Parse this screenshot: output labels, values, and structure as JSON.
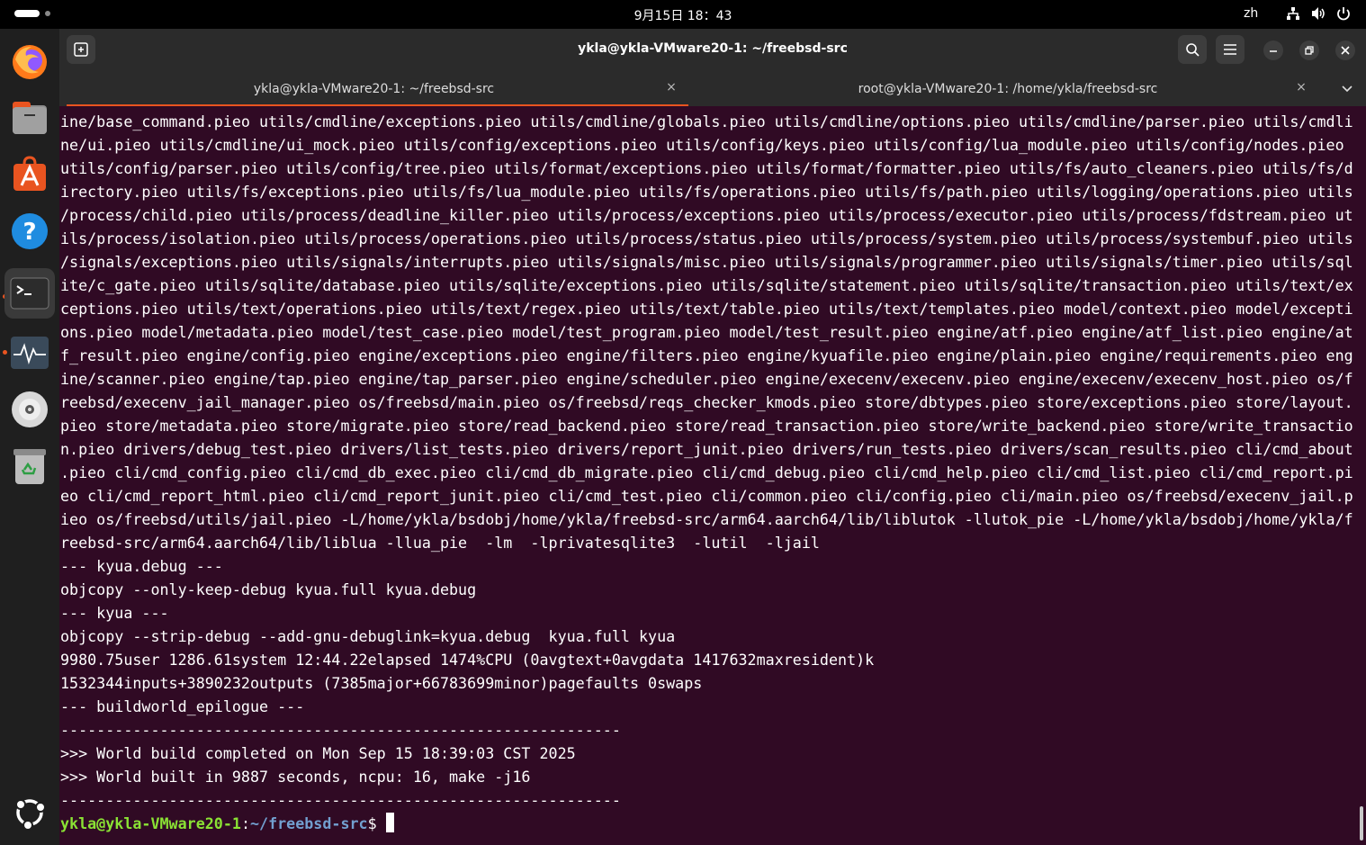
{
  "topbar": {
    "clock": "9月15日 18：43",
    "lang": "zh",
    "icons": [
      "network-icon",
      "volume-icon",
      "power-icon"
    ]
  },
  "dock": {
    "items": [
      "firefox-icon",
      "files-icon",
      "app-center-icon",
      "help-icon",
      "terminal-icon",
      "system-monitor-icon",
      "disc-icon",
      "trash-icon",
      "show-apps-icon"
    ]
  },
  "window": {
    "title": "ykla@ykla-VMware20-1: ~/freebsd-src",
    "tabs": [
      {
        "label": "ykla@ykla-VMware20-1: ~/freebsd-src",
        "active": true
      },
      {
        "label": "root@ykla-VMware20-1: /home/ykla/freebsd-src",
        "active": false
      }
    ],
    "close_glyph": "×"
  },
  "terminal": {
    "lines": [
      "ine/base_command.pieo utils/cmdline/exceptions.pieo utils/cmdline/globals.pieo utils/cmdline/options.pieo utils/cmdline/parser.pieo utils/cmdli",
      "ne/ui.pieo utils/cmdline/ui_mock.pieo utils/config/exceptions.pieo utils/config/keys.pieo utils/config/lua_module.pieo utils/config/nodes.pieo",
      "utils/config/parser.pieo utils/config/tree.pieo utils/format/exceptions.pieo utils/format/formatter.pieo utils/fs/auto_cleaners.pieo utils/fs/d",
      "irectory.pieo utils/fs/exceptions.pieo utils/fs/lua_module.pieo utils/fs/operations.pieo utils/fs/path.pieo utils/logging/operations.pieo utils",
      "/process/child.pieo utils/process/deadline_killer.pieo utils/process/exceptions.pieo utils/process/executor.pieo utils/process/fdstream.pieo ut",
      "ils/process/isolation.pieo utils/process/operations.pieo utils/process/status.pieo utils/process/system.pieo utils/process/systembuf.pieo utils",
      "/signals/exceptions.pieo utils/signals/interrupts.pieo utils/signals/misc.pieo utils/signals/programmer.pieo utils/signals/timer.pieo utils/sql",
      "ite/c_gate.pieo utils/sqlite/database.pieo utils/sqlite/exceptions.pieo utils/sqlite/statement.pieo utils/sqlite/transaction.pieo utils/text/ex",
      "ceptions.pieo utils/text/operations.pieo utils/text/regex.pieo utils/text/table.pieo utils/text/templates.pieo model/context.pieo model/excepti",
      "ons.pieo model/metadata.pieo model/test_case.pieo model/test_program.pieo model/test_result.pieo engine/atf.pieo engine/atf_list.pieo engine/at",
      "f_result.pieo engine/config.pieo engine/exceptions.pieo engine/filters.pieo engine/kyuafile.pieo engine/plain.pieo engine/requirements.pieo eng",
      "ine/scanner.pieo engine/tap.pieo engine/tap_parser.pieo engine/scheduler.pieo engine/execenv/execenv.pieo engine/execenv/execenv_host.pieo os/f",
      "reebsd/execenv_jail_manager.pieo os/freebsd/main.pieo os/freebsd/reqs_checker_kmods.pieo store/dbtypes.pieo store/exceptions.pieo store/layout.",
      "pieo store/metadata.pieo store/migrate.pieo store/read_backend.pieo store/read_transaction.pieo store/write_backend.pieo store/write_transactio",
      "n.pieo drivers/debug_test.pieo drivers/list_tests.pieo drivers/report_junit.pieo drivers/run_tests.pieo drivers/scan_results.pieo cli/cmd_about",
      ".pieo cli/cmd_config.pieo cli/cmd_db_exec.pieo cli/cmd_db_migrate.pieo cli/cmd_debug.pieo cli/cmd_help.pieo cli/cmd_list.pieo cli/cmd_report.pi",
      "eo cli/cmd_report_html.pieo cli/cmd_report_junit.pieo cli/cmd_test.pieo cli/common.pieo cli/config.pieo cli/main.pieo os/freebsd/execenv_jail.p",
      "ieo os/freebsd/utils/jail.pieo -L/home/ykla/bsdobj/home/ykla/freebsd-src/arm64.aarch64/lib/liblutok -llutok_pie -L/home/ykla/bsdobj/home/ykla/f",
      "reebsd-src/arm64.aarch64/lib/liblua -llua_pie  -lm  -lprivatesqlite3  -lutil  -ljail",
      "--- kyua.debug ---",
      "objcopy --only-keep-debug kyua.full kyua.debug",
      "--- kyua ---",
      "objcopy --strip-debug --add-gnu-debuglink=kyua.debug  kyua.full kyua",
      "9980.75user 1286.61system 12:44.22elapsed 1474%CPU (0avgtext+0avgdata 1417632maxresident)k",
      "1532344inputs+3890232outputs (7385major+66783699minor)pagefaults 0swaps",
      "--- buildworld_epilogue ---",
      "--------------------------------------------------------------",
      ">>> World build completed on Mon Sep 15 18:39:03 CST 2025",
      ">>> World built in 9887 seconds, ncpu: 16, make -j16",
      "--------------------------------------------------------------"
    ],
    "prompt": {
      "user_host": "ykla@ykla-VMware20-1",
      "sep": ":",
      "path": "~/freebsd-src",
      "symbol": "$ "
    }
  },
  "colors": {
    "terminal_bg": "#300a24",
    "accent": "#e95420",
    "prompt_user": "#8ae234",
    "prompt_path": "#729fcf"
  }
}
